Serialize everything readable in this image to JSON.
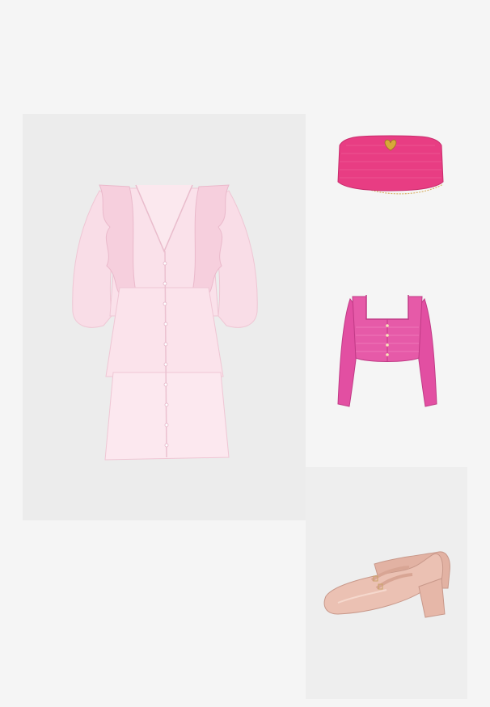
{
  "products": [
    {
      "id": "dress",
      "icon": "ruffled-dress-image",
      "color": "#f8d9e3"
    },
    {
      "id": "bag",
      "icon": "woven-clutch-bag-image",
      "color": "#e83d83"
    },
    {
      "id": "cardigan",
      "icon": "cropped-knit-cardigan-image",
      "color": "#e24fa2"
    },
    {
      "id": "shoes",
      "icon": "mary-jane-pumps-image",
      "color": "#ebc1b3"
    }
  ],
  "colors": {
    "page_background": "#f5f5f5",
    "dress_panel_background": "#ececec",
    "shoe_panel_background": "#eeeeee"
  }
}
